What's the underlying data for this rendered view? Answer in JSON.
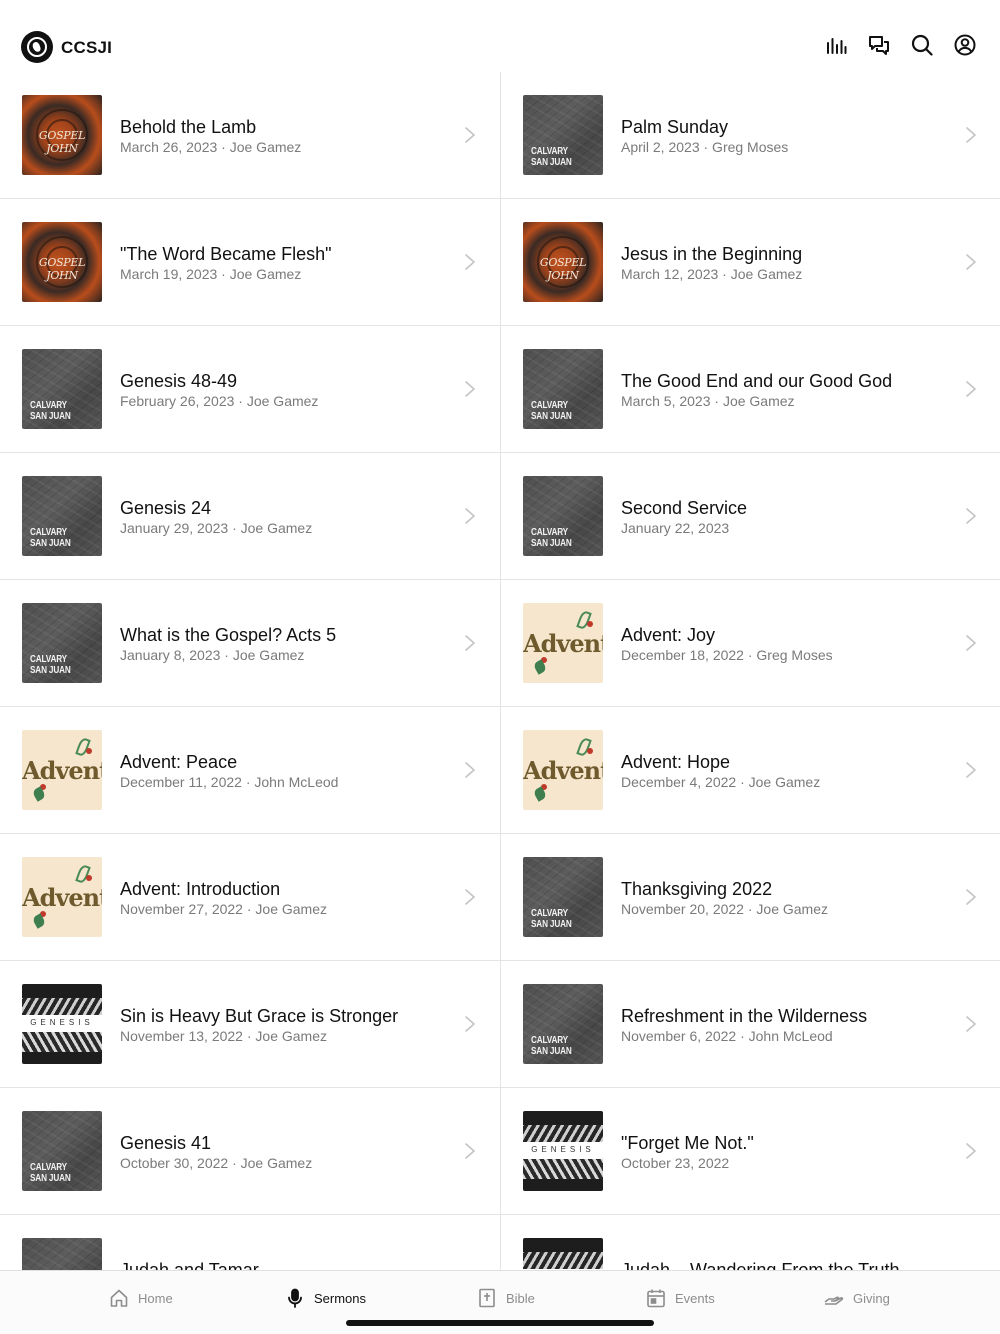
{
  "header": {
    "brand": "CCSJI",
    "icons": [
      "equalizer-icon",
      "chat-icon",
      "search-icon",
      "account-icon"
    ]
  },
  "sermons": [
    {
      "title": "Behold the Lamb",
      "meta": "March 26, 2023 · Joe Gamez",
      "art": "gospel"
    },
    {
      "title": "Palm Sunday",
      "meta": "April 2, 2023 · Greg Moses",
      "art": "calvary"
    },
    {
      "title": "\"The Word Became Flesh\"",
      "meta": "March 19, 2023 · Joe Gamez",
      "art": "gospel"
    },
    {
      "title": "Jesus in the Beginning",
      "meta": "March 12, 2023 · Joe Gamez",
      "art": "gospel"
    },
    {
      "title": "Genesis 48-49",
      "meta": "February 26, 2023 · Joe Gamez",
      "art": "calvary"
    },
    {
      "title": "The Good End and our Good God",
      "meta": "March 5, 2023 · Joe Gamez",
      "art": "calvary"
    },
    {
      "title": "Genesis 24",
      "meta": "January 29, 2023 · Joe Gamez",
      "art": "calvary"
    },
    {
      "title": "Second Service",
      "meta": "January 22, 2023",
      "art": "calvary"
    },
    {
      "title": "What is the Gospel? Acts 5",
      "meta": "January 8, 2023 · Joe Gamez",
      "art": "calvary"
    },
    {
      "title": "Advent: Joy",
      "meta": "December 18, 2022 · Greg Moses",
      "art": "advent"
    },
    {
      "title": "Advent: Peace",
      "meta": "December 11, 2022 · John McLeod",
      "art": "advent"
    },
    {
      "title": "Advent: Hope",
      "meta": "December 4, 2022 · Joe Gamez",
      "art": "advent"
    },
    {
      "title": "Advent: Introduction",
      "meta": "November 27, 2022 · Joe Gamez",
      "art": "advent"
    },
    {
      "title": "Thanksgiving 2022",
      "meta": "November 20, 2022 · Joe Gamez",
      "art": "calvary"
    },
    {
      "title": "Sin is Heavy But Grace is Stronger",
      "meta": "November 13, 2022 · Joe Gamez",
      "art": "genesis"
    },
    {
      "title": "Refreshment in the Wilderness",
      "meta": "November 6, 2022 · John McLeod",
      "art": "calvary"
    },
    {
      "title": "Genesis 41",
      "meta": "October 30, 2022 · Joe Gamez",
      "art": "calvary"
    },
    {
      "title": "\"Forget Me Not.\"",
      "meta": "October 23, 2022",
      "art": "genesis"
    },
    {
      "title": "Judah and Tamar",
      "meta": "",
      "art": "calvary"
    },
    {
      "title": "Judah – Wandering From the Truth",
      "meta": "",
      "art": "genesis"
    }
  ],
  "art_labels": {
    "gospel": "GOSPEL JOHN",
    "calvary_line1": "CALVARY",
    "calvary_line2": "SAN JUAN",
    "advent": "Advent",
    "genesis": "GENESIS"
  },
  "tabs": [
    {
      "label": "Home",
      "icon": "home-icon",
      "active": false
    },
    {
      "label": "Sermons",
      "icon": "microphone-icon",
      "active": true
    },
    {
      "label": "Bible",
      "icon": "bible-icon",
      "active": false
    },
    {
      "label": "Events",
      "icon": "calendar-icon",
      "active": false
    },
    {
      "label": "Giving",
      "icon": "giving-hand-icon",
      "active": false
    }
  ],
  "colors": {
    "text": "#111111",
    "muted": "#7a7a7a",
    "divider": "#e4e4e4",
    "gospel_orange": "#c2531f",
    "advent_bg": "#f5e6cd"
  }
}
